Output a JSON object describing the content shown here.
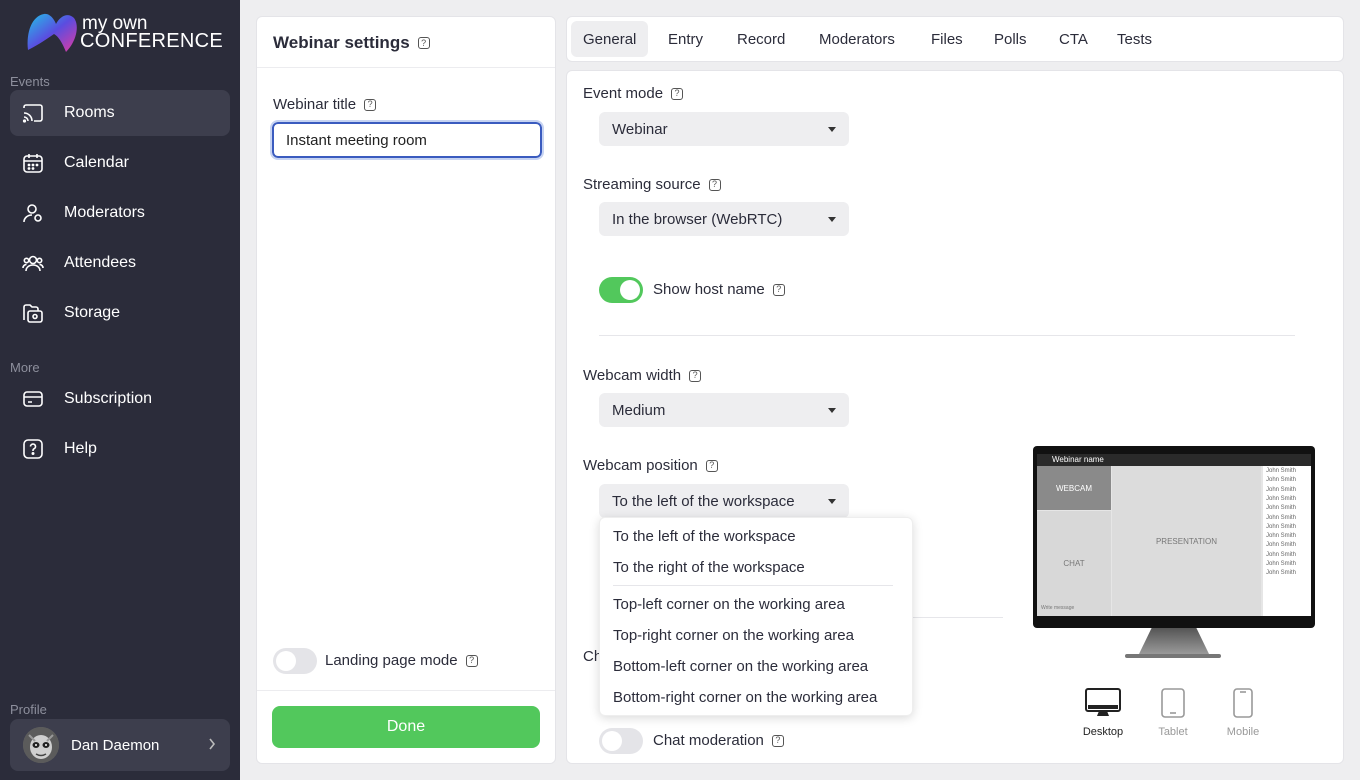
{
  "app": {
    "logo_line1": "my own",
    "logo_line2": "CONFERENCE"
  },
  "sidebar": {
    "events_label": "Events",
    "more_label": "More",
    "profile_label": "Profile",
    "items": [
      {
        "label": "Rooms",
        "icon": "cast-icon",
        "active": true
      },
      {
        "label": "Calendar",
        "icon": "calendar-icon"
      },
      {
        "label": "Moderators",
        "icon": "user-icon"
      },
      {
        "label": "Attendees",
        "icon": "users-icon"
      },
      {
        "label": "Storage",
        "icon": "folder-icon"
      },
      {
        "label": "Subscription",
        "icon": "card-icon"
      },
      {
        "label": "Help",
        "icon": "help-icon"
      }
    ],
    "profile_name": "Dan Daemon"
  },
  "settings": {
    "title": "Webinar settings",
    "webinar_title_label": "Webinar title",
    "webinar_title_value": "Instant meeting room",
    "landing_page_mode_label": "Landing page mode",
    "landing_page_mode_on": false,
    "done_label": "Done"
  },
  "tabs": [
    {
      "label": "General",
      "active": true
    },
    {
      "label": "Entry"
    },
    {
      "label": "Record"
    },
    {
      "label": "Moderators"
    },
    {
      "label": "Files"
    },
    {
      "label": "Polls"
    },
    {
      "label": "CTA"
    },
    {
      "label": "Tests"
    }
  ],
  "general": {
    "event_mode_label": "Event mode",
    "event_mode_value": "Webinar",
    "streaming_source_label": "Streaming source",
    "streaming_source_value": "In the browser (WebRTC)",
    "show_host_name_label": "Show host name",
    "show_host_name_on": true,
    "webcam_width_label": "Webcam width",
    "webcam_width_value": "Medium",
    "webcam_position_label": "Webcam position",
    "webcam_position_value": "To the left of the workspace",
    "webcam_position_options": [
      "To the left of the workspace",
      "To the right of the workspace",
      "Top-left corner on the working area",
      "Top-right corner on the working area",
      "Bottom-left corner on the working area",
      "Bottom-right corner on the working area"
    ],
    "chat_label_partial": "Ch",
    "chat_moderation_label": "Chat moderation",
    "chat_moderation_on": false
  },
  "preview": {
    "webinar_name": "Webinar name",
    "webcam": "WEBCAM",
    "chat": "CHAT",
    "presentation": "PRESENTATION",
    "write_message": "Write message",
    "attendee_name": "John Smith",
    "attendee_rows": 12,
    "devices": [
      {
        "label": "Desktop",
        "icon": "desktop-icon",
        "active": true
      },
      {
        "label": "Tablet",
        "icon": "tablet-icon"
      },
      {
        "label": "Mobile",
        "icon": "mobile-icon"
      }
    ]
  },
  "colors": {
    "sidebar_bg": "#2b2c3a",
    "accent_green": "#52c85c",
    "focus_blue": "#3a5bbf"
  }
}
